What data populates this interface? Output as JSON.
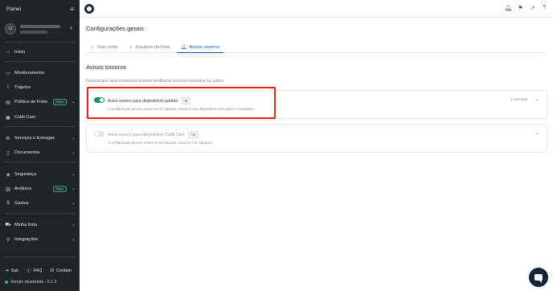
{
  "sidebar": {
    "title": "Painel",
    "menu_icon": "hamburger-icon",
    "avatar_initials": "CI",
    "items": [
      {
        "label": "Início",
        "icon": "home-icon"
      },
      {
        "label": "Monitoramento",
        "icon": "monitor-icon"
      },
      {
        "label": "Trajetos",
        "icon": "route-icon"
      },
      {
        "label": "Política de Frota",
        "icon": "policy-icon",
        "badge": "Novo"
      },
      {
        "label": "Cobli Cam",
        "icon": "camera-icon"
      },
      {
        "label": "Serviços e Entregas",
        "icon": "services-icon"
      },
      {
        "label": "Documentos",
        "icon": "documents-icon"
      },
      {
        "label": "Segurança",
        "icon": "shield-icon"
      },
      {
        "label": "Análises",
        "icon": "analytics-icon",
        "badge": "Novo"
      },
      {
        "label": "Gastos",
        "icon": "money-icon"
      },
      {
        "label": "Minha frota",
        "icon": "fleet-icon"
      },
      {
        "label": "Integrações",
        "icon": "integrations-icon"
      }
    ],
    "bottom": {
      "sair": "Sair",
      "faq": "FAQ",
      "contato": "Contato"
    },
    "version": "Versão atualizada - 5.1.3"
  },
  "header": {
    "logo": "cobli-logo",
    "icons": [
      "bell-icon",
      "flag-icon",
      "external-link-icon",
      "help-icon"
    ]
  },
  "main": {
    "page_title": "Configurações gerais",
    "tabs": [
      {
        "label": "Sua conta",
        "icon": "user-icon"
      },
      {
        "label": "Usuários da frota",
        "icon": "users-icon"
      },
      {
        "label": "Avisos sonoros",
        "icon": "bell-icon",
        "active": true
      }
    ],
    "section_title": "Avisos sonoros",
    "section_desc": "Garanta que seus motoristas tenham feedbacks sonoros imediatos na cabine",
    "cards": [
      {
        "title": "Aviso sonoro para dispositivos padrão",
        "chip": "⊞",
        "desc": "A configuração desses avisos só irá impactar veículos com dispositivos removíveis e instalados.",
        "count": "2 veículos",
        "enabled": true
      },
      {
        "title": "Aviso sonoro para dispositivos Cobli Cam",
        "chip": "CB",
        "desc": "A configuração desses avisos só irá impactar veículos com câmeras.",
        "count": "",
        "enabled": false
      }
    ]
  },
  "colors": {
    "sidebar_bg": "#1f2428",
    "accent": "#1e5a9a",
    "toggle_on": "#1d8c6b",
    "highlight": "#d92a1c",
    "chat_bg": "#14233a"
  }
}
